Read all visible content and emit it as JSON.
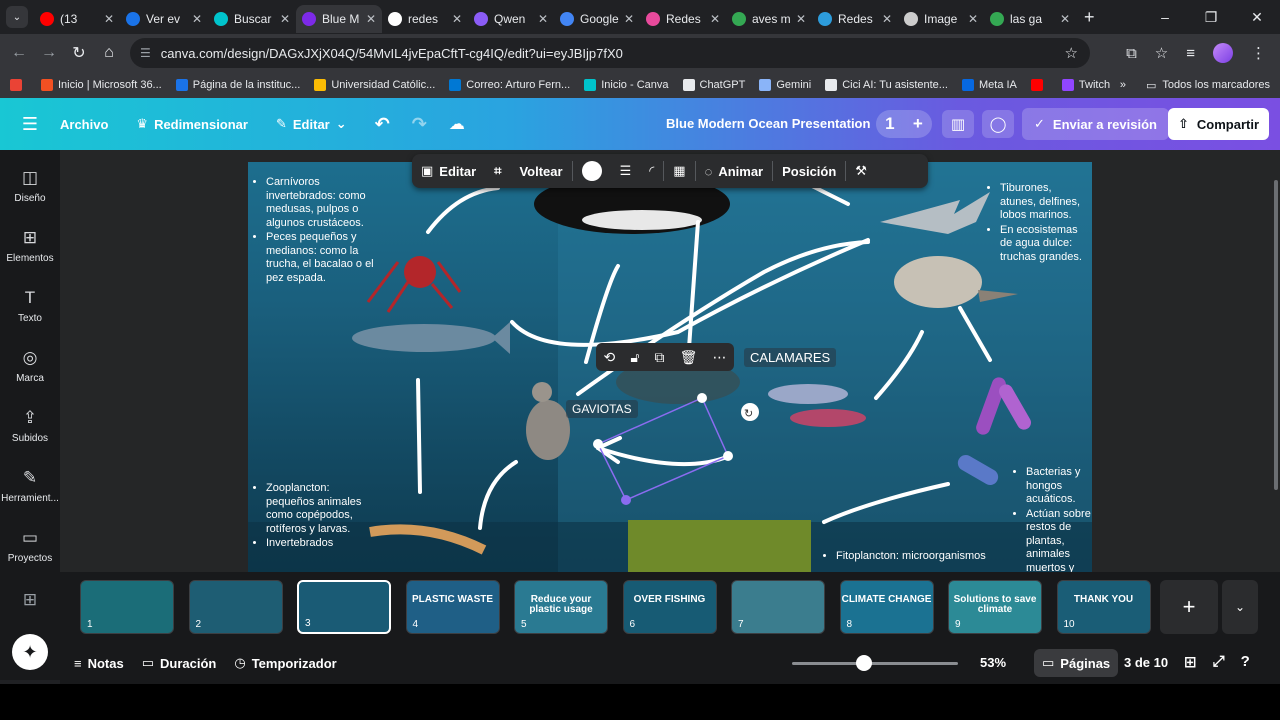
{
  "browser": {
    "tabs": [
      {
        "label": "(13",
        "color": "#ff0000",
        "active": false
      },
      {
        "label": "Ver ev",
        "color": "#1a73e8",
        "active": false
      },
      {
        "label": "Buscar",
        "color": "#00c4cc",
        "active": false
      },
      {
        "label": "Blue M",
        "color": "#7d2ae8",
        "active": true
      },
      {
        "label": "redes",
        "color": "#ffffff",
        "active": false
      },
      {
        "label": "Qwen",
        "color": "#8b5cf6",
        "active": false
      },
      {
        "label": "Google",
        "color": "#4285f4",
        "active": false
      },
      {
        "label": "Redes",
        "color": "#e84a9c",
        "active": false
      },
      {
        "label": "aves m",
        "color": "#34a853",
        "active": false
      },
      {
        "label": "Redes",
        "color": "#2d9cdb",
        "active": false
      },
      {
        "label": "Image",
        "color": "#cccccc",
        "active": false
      },
      {
        "label": "las ga",
        "color": "#34a853",
        "active": false
      }
    ],
    "url": "canva.com/design/DAGxJXjX04Q/54MvIL4jvEpaCftT-cg4IQ/edit?ui=eyJBIjp7fX0",
    "bookmarks": [
      {
        "label": "Inicio | Microsoft 36...",
        "color": "#f25022"
      },
      {
        "label": "Página de la instituc...",
        "color": "#1a73e8"
      },
      {
        "label": "Universidad Católic...",
        "color": "#fbbc04"
      },
      {
        "label": "Correo: Arturo Fern...",
        "color": "#0078d4"
      },
      {
        "label": "Inicio - Canva",
        "color": "#00c4cc"
      },
      {
        "label": "ChatGPT",
        "color": "#e8eaed"
      },
      {
        "label": "Gemini",
        "color": "#8ab4f8"
      },
      {
        "label": "Cici AI: Tu asistente...",
        "color": "#e8eaed"
      },
      {
        "label": "Meta IA",
        "color": "#0668e1"
      },
      {
        "label": "",
        "color": "#ff0000"
      },
      {
        "label": "Twitch",
        "color": "#9146ff"
      }
    ],
    "all_bookmarks": "Todos los marcadores"
  },
  "header": {
    "archivo": "Archivo",
    "redimensionar": "Redimensionar",
    "editar": "Editar",
    "doc_title": "Blue Modern Ocean Presentation",
    "collab_count": "1",
    "review": "Enviar a revisión",
    "share": "Compartir"
  },
  "sidebar": {
    "items": [
      {
        "label": "Diseño",
        "icon": "layout-icon",
        "glyph": "◫"
      },
      {
        "label": "Elementos",
        "icon": "elements-icon",
        "glyph": "⊞"
      },
      {
        "label": "Texto",
        "icon": "text-icon",
        "glyph": "T"
      },
      {
        "label": "Marca",
        "icon": "brand-icon",
        "glyph": "◎"
      },
      {
        "label": "Subidos",
        "icon": "upload-icon",
        "glyph": "⇪"
      },
      {
        "label": "Herramient...",
        "icon": "tools-icon",
        "glyph": "✎"
      },
      {
        "label": "Proyectos",
        "icon": "folder-icon",
        "glyph": "▭"
      }
    ]
  },
  "toolbar": {
    "editar": "Editar",
    "voltear": "Voltear",
    "animar": "Animar",
    "posicion": "Posición"
  },
  "slide": {
    "left_top": [
      "Carnívoros invertebrados: como medusas, pulpos o algunos crustáceos.",
      "Peces pequeños y medianos: como la trucha, el bacalao o el pez espada."
    ],
    "right_top": [
      "Tiburones, atunes, delfines, lobos marinos.",
      "En ecosistemas de agua dulce: truchas grandes."
    ],
    "left_bottom": [
      "Zooplancton: pequeños animales como copépodos, rotíferos y larvas.",
      "Invertebrados"
    ],
    "right_bottom": [
      "Bacterias y hongos acuáticos.",
      "Actúan sobre restos de plantas, animales muertos y"
    ],
    "bottom_center": "Fitoplancton: microorganismos",
    "gaviotas": "GAVIOTAS",
    "calamares": "CALAMARES"
  },
  "thumbnails": [
    {
      "n": "1",
      "title": "",
      "bg": "#1b6d78"
    },
    {
      "n": "2",
      "title": "",
      "bg": "#1e5d73"
    },
    {
      "n": "3",
      "title": "",
      "bg": "#1a5b75",
      "selected": true
    },
    {
      "n": "4",
      "title": "PLASTIC WASTE",
      "bg": "#1f5f86"
    },
    {
      "n": "5",
      "title": "Reduce your plastic usage",
      "bg": "#2a7a92"
    },
    {
      "n": "6",
      "title": "OVER FISHING",
      "bg": "#175b74"
    },
    {
      "n": "7",
      "title": "",
      "bg": "#3b7d8e"
    },
    {
      "n": "8",
      "title": "CLIMATE CHANGE",
      "bg": "#1b7292"
    },
    {
      "n": "9",
      "title": "Solutions to save climate",
      "bg": "#2c8a96"
    },
    {
      "n": "10",
      "title": "THANK YOU",
      "bg": "#1a5d76"
    }
  ],
  "bottom": {
    "notes": "Notas",
    "duration": "Duración",
    "timer": "Temporizador",
    "zoom": "53%",
    "pages": "Páginas",
    "page_count": "3 de 10"
  }
}
